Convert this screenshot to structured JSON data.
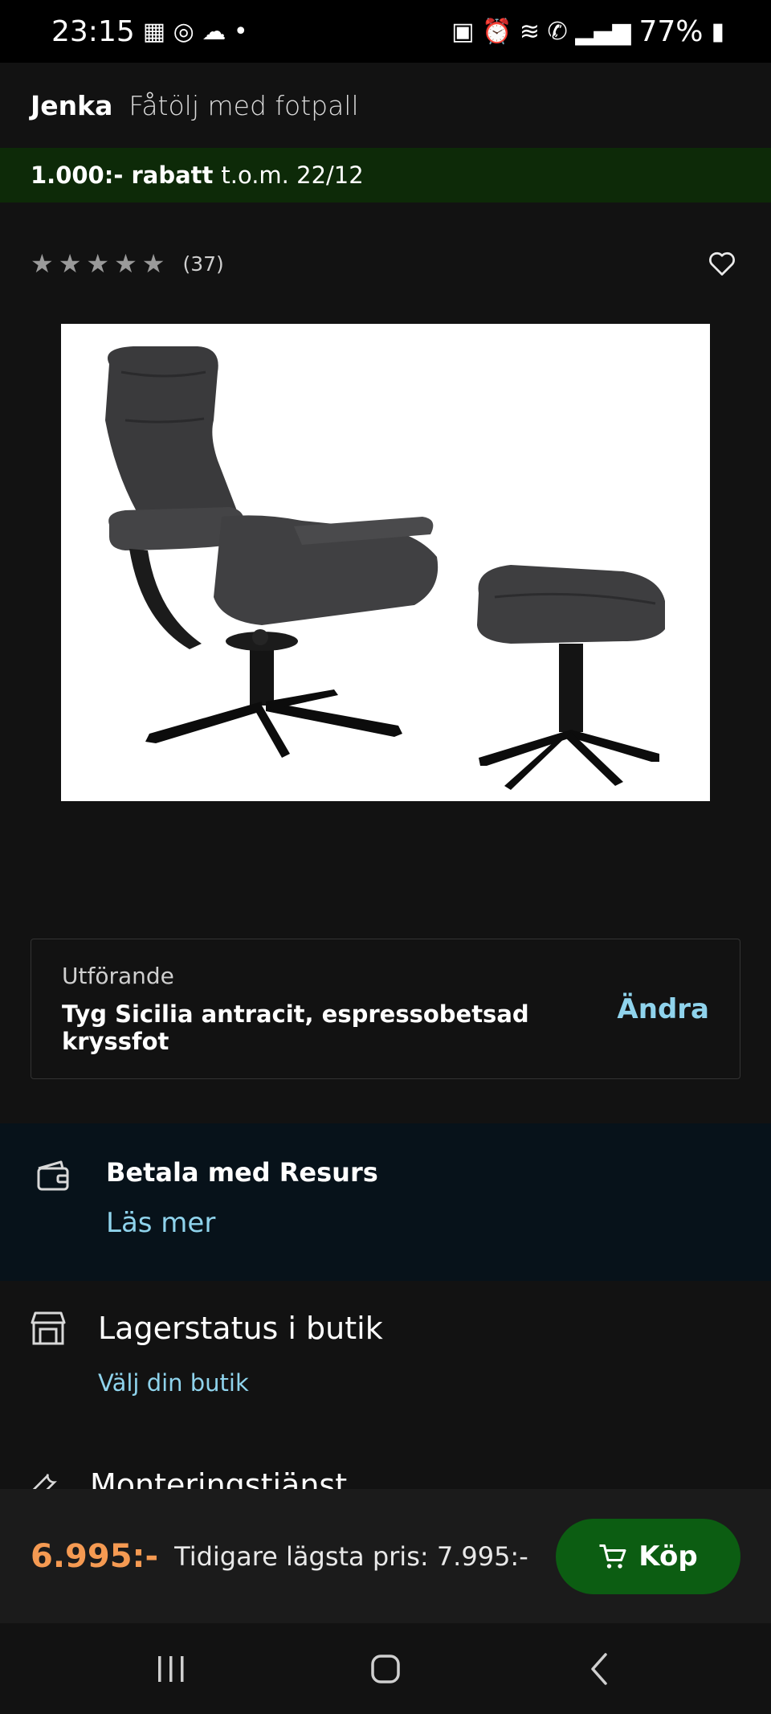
{
  "status_bar": {
    "time": "23:15",
    "battery": "77%"
  },
  "header": {
    "brand": "Jenka",
    "subtitle": "Fåtölj med fotpall"
  },
  "promo": {
    "discount": "1.000:- rabatt",
    "until": "t.o.m. 22/12"
  },
  "rating": {
    "stars": "★★★★★",
    "count": "(37)",
    "value": 4.5
  },
  "variant": {
    "label": "Utförande",
    "value": "Tyg Sicilia antracit, espressobetsad kryssfot",
    "change_label": "Ändra"
  },
  "payment": {
    "title": "Betala med Resurs",
    "link": "Läs mer"
  },
  "stock": {
    "title": "Lagerstatus i butik",
    "link": "Välj din butik"
  },
  "assembly": {
    "title": "Monteringstjänst"
  },
  "buy_bar": {
    "price": "6.995:-",
    "previous_price": "Tidigare lägsta pris: 7.995:-",
    "buy_label": "Köp"
  },
  "colors": {
    "accent_link": "#8fd3ec",
    "price": "#f59a52",
    "buy_button": "#0c5d12",
    "promo_bg": "#0d2a08"
  }
}
